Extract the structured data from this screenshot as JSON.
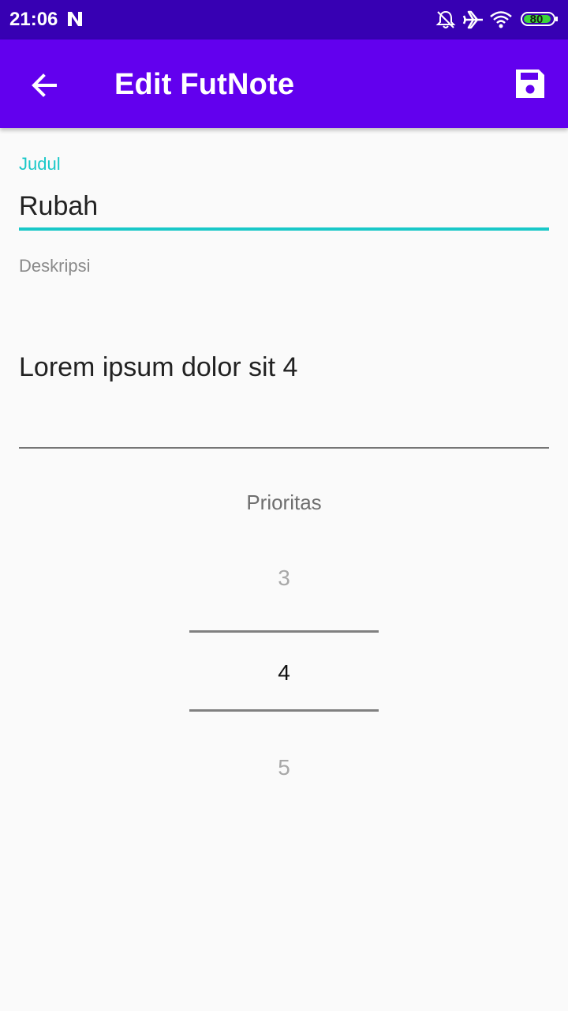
{
  "status_bar": {
    "time": "21:06",
    "battery_level": "80",
    "icons": [
      "n-icon",
      "bell-off-icon",
      "airplane-icon",
      "wifi-icon",
      "battery-icon"
    ]
  },
  "app_bar": {
    "title": "Edit FutNote",
    "back_icon": "arrow-back-icon",
    "save_icon": "save-icon",
    "background_color": "#6200ee",
    "status_bar_color": "#3700b3"
  },
  "form": {
    "judul": {
      "label": "Judul",
      "value": "Rubah",
      "accent_color": "#19c8c8"
    },
    "deskripsi": {
      "label": "Deskripsi",
      "value": "Lorem ipsum dolor sit 4"
    }
  },
  "priority": {
    "label": "Prioritas",
    "options_visible": [
      "3",
      "4",
      "5"
    ],
    "selected": "4"
  }
}
